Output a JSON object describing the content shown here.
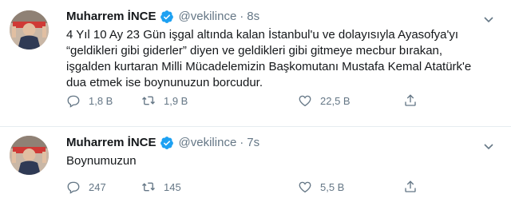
{
  "tweets": [
    {
      "name": "Muharrem İNCE",
      "handle": "@vekilince",
      "separator": "·",
      "time": "8s",
      "text": "4 Yıl 10 Ay 23 Gün işgal altında kalan İstanbul'u ve dolayısıyla Ayasofya'yı\n“geldikleri gibi giderler” diyen ve geldikleri gibi gitmeye mecbur bırakan,\nişgalden kurtaran Milli Mücadelemizin Başkomutanı Mustafa Kemal Atatürk'e\ndua etmek ise boynunuzun borcudur.",
      "replies": "1,8 B",
      "retweets": "1,9 B",
      "likes": "22,5 B"
    },
    {
      "name": "Muharrem İNCE",
      "handle": "@vekilince",
      "separator": "·",
      "time": "7s",
      "text": "Boynumuzun",
      "replies": "247",
      "retweets": "145",
      "likes": "5,5 B"
    }
  ],
  "icons": {
    "verified": "verified-badge-icon",
    "reply": "reply-icon",
    "retweet": "retweet-icon",
    "like": "heart-icon",
    "share": "share-icon",
    "menu": "chevron-down-icon"
  },
  "colors": {
    "accent": "#1da1f2",
    "muted": "#657786",
    "text": "#14171a"
  }
}
